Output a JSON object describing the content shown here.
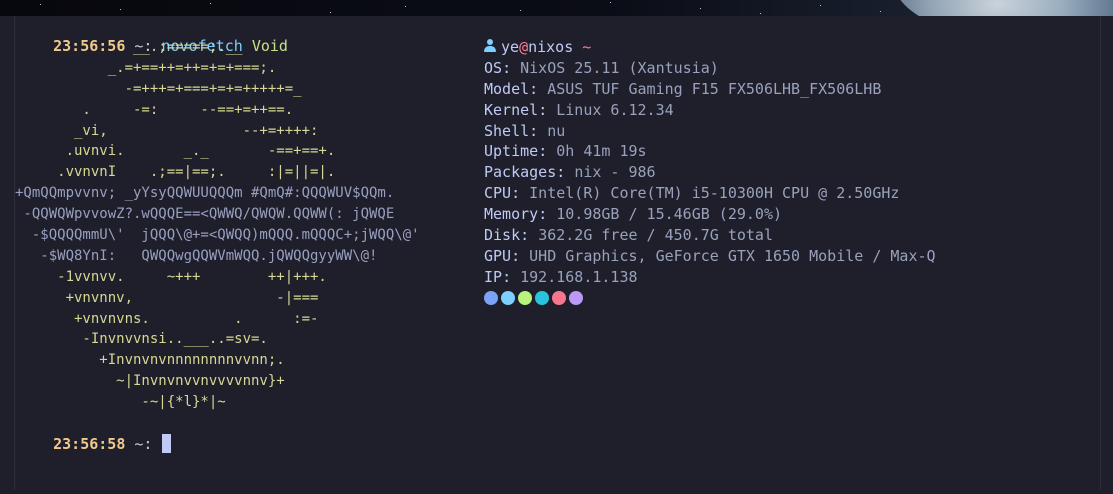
{
  "terminal": {
    "prompt1": {
      "time": "23:56:56",
      "dir": "~:",
      "command": "novofetch",
      "argument": "Void"
    },
    "prompt2": {
      "time": "23:56:58",
      "dir": "~:"
    }
  },
  "logo": {
    "lines": [
      {
        "text": "              __.;=====;.__",
        "tone": "y"
      },
      {
        "text": "           _.=+==++=++=+=+===;.",
        "tone": "y"
      },
      {
        "text": "             -=+++=+===+=+=+++++=_",
        "tone": "y"
      },
      {
        "text": "        .     -=:     --==+=++==.",
        "tone": "y"
      },
      {
        "text": "       _vi,                --+=++++:",
        "tone": "y"
      },
      {
        "text": "      .uvnvi.       _._       -==+==+.",
        "tone": "y"
      },
      {
        "text": "     .vvnvnI    .;==|==;.     :|=||=|.",
        "tone": "y"
      },
      {
        "text": "+QmQQmpvvnv; _yYsyQQWUUQQQm #QmQ#:QQQWUV$QQm.",
        "tone": "g"
      },
      {
        "text": " -QQWQWpvvowZ?.wQQQE==<QWWQ/QWQW.QQWW(: jQWQE",
        "tone": "g"
      },
      {
        "text": "  -$QQQQmmU\\'  jQQQ\\@+=<QWQQ)mQQQ.mQQQC+;jWQQ\\@'",
        "tone": "g"
      },
      {
        "text": "   -$WQ8YnI:   QWQQwgQQWVmWQQ.jQWQQgyyWW\\@!",
        "tone": "g"
      },
      {
        "text": "     -1vvnvv.     ~+++        ++|+++.",
        "tone": "y"
      },
      {
        "text": "      +vnvnnv,                 -|===",
        "tone": "y"
      },
      {
        "text": "       +vnvnvns.          .      :=-",
        "tone": "y"
      },
      {
        "text": "        -Invnvvnsi..___..=sv=.",
        "tone": "y"
      },
      {
        "text": "          +Invnvnvnnnnnnnnvvnn;.",
        "tone": "y"
      },
      {
        "text": "            ~|Invnvnvvnvvvvnnv}+",
        "tone": "y"
      },
      {
        "text": "               -~|{*l}*|~",
        "tone": "y"
      }
    ]
  },
  "info": {
    "user": "ye",
    "at": "@",
    "host": "nixos",
    "tilde": "~",
    "rows": [
      {
        "key": "OS",
        "value": "NixOS 25.11 (Xantusia)"
      },
      {
        "key": "Model",
        "value": "ASUS TUF Gaming F15 FX506LHB_FX506LHB"
      },
      {
        "key": "Kernel",
        "value": "Linux 6.12.34"
      },
      {
        "key": "Shell",
        "value": "nu"
      },
      {
        "key": "Uptime",
        "value": "0h 41m 19s"
      },
      {
        "key": "Packages",
        "value": "nix - 986"
      },
      {
        "key": "CPU",
        "value": "Intel(R) Core(TM) i5-10300H CPU @ 2.50GHz"
      },
      {
        "key": "Memory",
        "value": "10.98GB / 15.46GB (29.0%)"
      },
      {
        "key": "Disk",
        "value": "362.2G free / 450.7G total"
      },
      {
        "key": "GPU",
        "value": "UHD Graphics, GeForce GTX 1650 Mobile / Max-Q"
      },
      {
        "key": "IP",
        "value": "192.168.1.138"
      }
    ],
    "separator": ": ",
    "swatch_colors": [
      "#7aa2f7",
      "#7dcfff",
      "#b9f27c",
      "#2ac3de",
      "#f7768e",
      "#bb9af7"
    ]
  },
  "colors": {
    "timestamp": "#f2c98c",
    "command": "#7dcfff",
    "argument": "#c8e08a",
    "key": "#c0caf5",
    "value": "#9aa1bc",
    "logo_yellow": "#d6d893",
    "logo_gray": "#9a9fc0",
    "background": "#1e1f2a"
  }
}
